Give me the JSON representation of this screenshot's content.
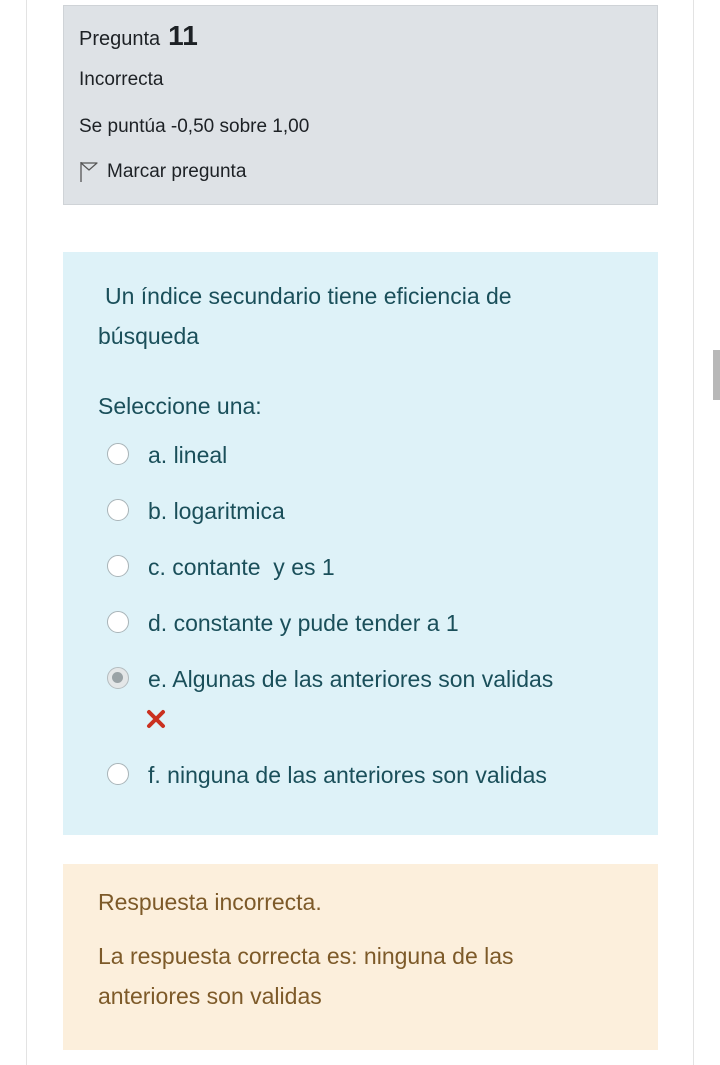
{
  "question_info": {
    "label": "Pregunta",
    "number": "11",
    "state": "Incorrecta",
    "grade": "Se puntúa -0,50 sobre 1,00",
    "flag_label": "Marcar pregunta"
  },
  "question": {
    "text": "Un índice secundario tiene eficiencia de búsqueda",
    "prompt": "Seleccione una:",
    "options": [
      {
        "label": "a. lineal",
        "checked": false
      },
      {
        "label": "b. logaritmica",
        "checked": false
      },
      {
        "label": "c. contante  y es 1",
        "checked": false
      },
      {
        "label": "d. constante y pude tender a 1",
        "checked": false
      },
      {
        "label": "e. Algunas de las anteriores son validas",
        "checked": true
      },
      {
        "label": "f. ninguna de las anteriores son validas",
        "checked": false
      }
    ],
    "wrong_icon": "cross-icon"
  },
  "feedback": {
    "title": "Respuesta incorrecta.",
    "correct_answer": "La respuesta correcta es: ninguna de las anteriores son validas"
  },
  "colors": {
    "info_bg": "#dee2e6",
    "question_bg": "#def2f8",
    "feedback_bg": "#fcefdc",
    "wrong": "#ca3120"
  }
}
